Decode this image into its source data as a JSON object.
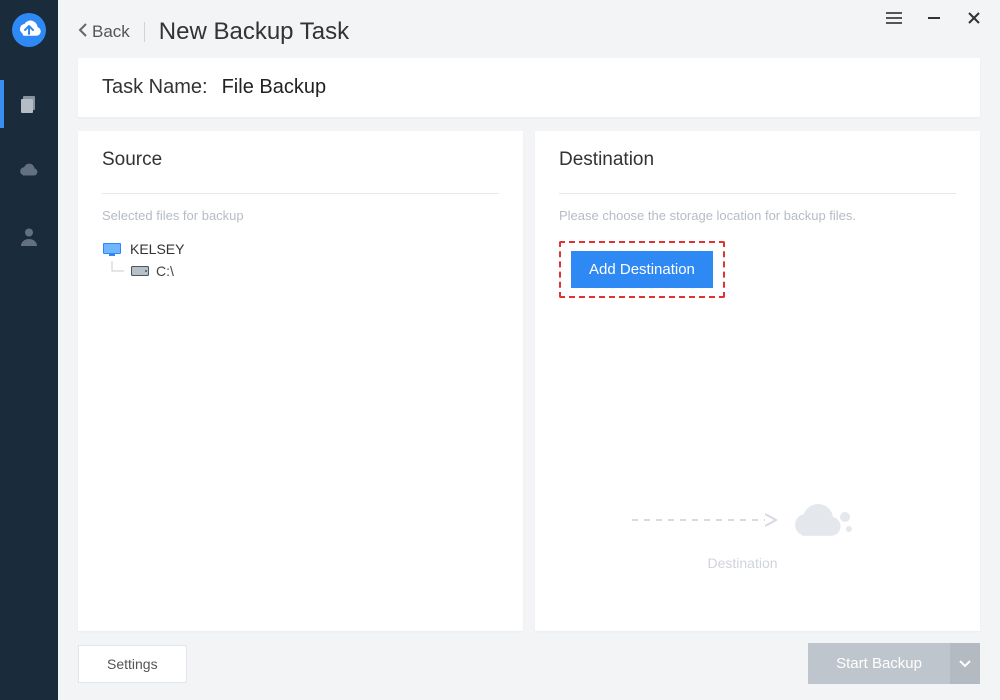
{
  "header": {
    "back_label": "Back",
    "title": "New Backup Task"
  },
  "taskname": {
    "label": "Task Name:",
    "value": "File Backup"
  },
  "source": {
    "heading": "Source",
    "hint": "Selected files for backup",
    "root_name": "KELSEY",
    "child_name": "C:\\"
  },
  "destination": {
    "heading": "Destination",
    "hint": "Please choose the storage location for backup files.",
    "add_button": "Add Destination",
    "placeholder_label": "Destination"
  },
  "footer": {
    "settings": "Settings",
    "start": "Start Backup"
  }
}
